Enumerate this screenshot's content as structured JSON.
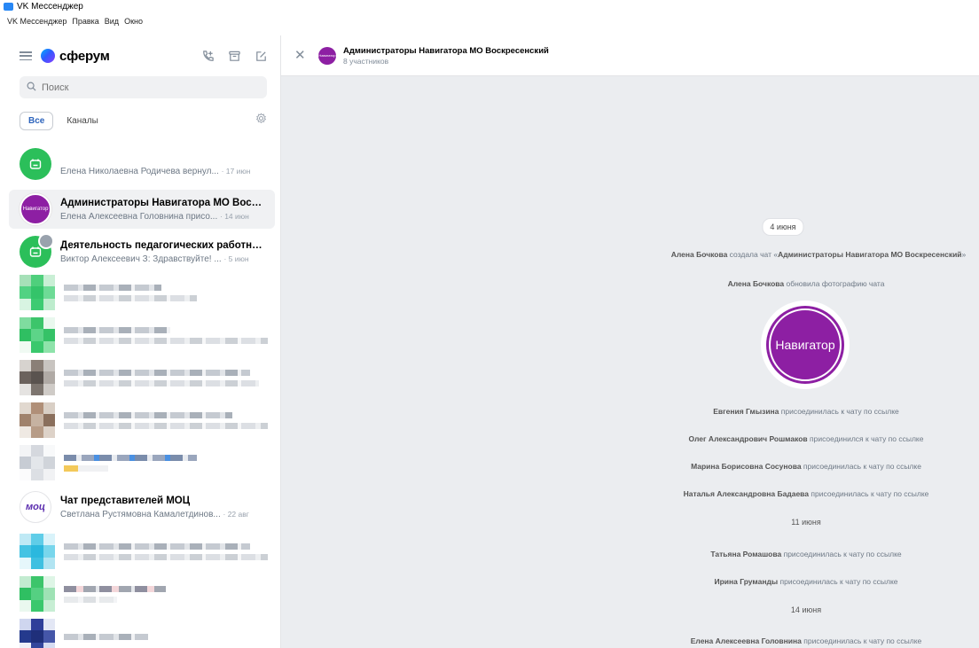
{
  "window": {
    "title": "VK Мессенджер"
  },
  "menubar": [
    "VK Мессенджер",
    "Правка",
    "Вид",
    "Окно"
  ],
  "app": {
    "brand": "сферум"
  },
  "search": {
    "placeholder": "Поиск"
  },
  "filters": {
    "all": "Все",
    "channels": "Каналы"
  },
  "chats": [
    {
      "title": "",
      "preview": "Елена Николаевна Родичева вернул...",
      "time": "· 17 июн",
      "avatar": "green"
    },
    {
      "title": "Администраторы Навигатора МО Воскр...",
      "preview": "Елена Алексеевна Головнина присо...",
      "time": "· 14 июн",
      "avatar": "purple",
      "avatar_text": "Навигатор"
    },
    {
      "title": "Деятельность педагогических работник...",
      "preview": "Виктор Алексеевич З: Здравствуйте! ...",
      "time": "· 5 июн",
      "avatar": "green"
    },
    {
      "title": "Чат представителей МОЦ",
      "preview": "Светлана Рустямовна Камалетдинов...",
      "time": "· 22 авг",
      "avatar": "moc",
      "avatar_text": "моц"
    }
  ],
  "header": {
    "title": "Администраторы Навигатора МО Воскресенский",
    "subtitle": "8 участников",
    "avatar_text": "Навигатор"
  },
  "feed": {
    "date1": "4 июня",
    "ev1_name": "Алена Бочкова",
    "ev1_text": " создала чат «",
    "ev1_chat": "Администраторы Навигатора МО Воскресенский",
    "ev1_end": "»",
    "ev2_name": "Алена Бочкова",
    "ev2_text": " обновила фотографию чата",
    "photo_text": "Навигатор",
    "ev3_name": "Евгения Гмызина",
    "ev3_text": " присоединилась к чату по ссылке",
    "ev4_name": "Олег Александрович Рошмаков",
    "ev4_text": " присоединился к чату по ссылке",
    "ev5_name": "Марина Борисовна Сосунова",
    "ev5_text": " присоединилась к чату по ссылке",
    "ev6_name": "Наталья Александровна Бадаева",
    "ev6_text": " присоединилась к чату по ссылке",
    "date2": "11 июня",
    "ev7_name": "Татьяна Ромашова",
    "ev7_text": " присоединилась к чату по ссылке",
    "ev8_name": "Ирина Груманды",
    "ev8_text": " присоединилась к чату по ссылке",
    "date3": "14 июня",
    "ev9_name": "Елена Алексеевна Головнина",
    "ev9_text": " присоединилась к чату по ссылке"
  },
  "colors": {
    "accent": "#2d64bc",
    "green": "#2bbf5a",
    "purple": "#8d1fa3",
    "chat_bg": "#ebedf0"
  }
}
